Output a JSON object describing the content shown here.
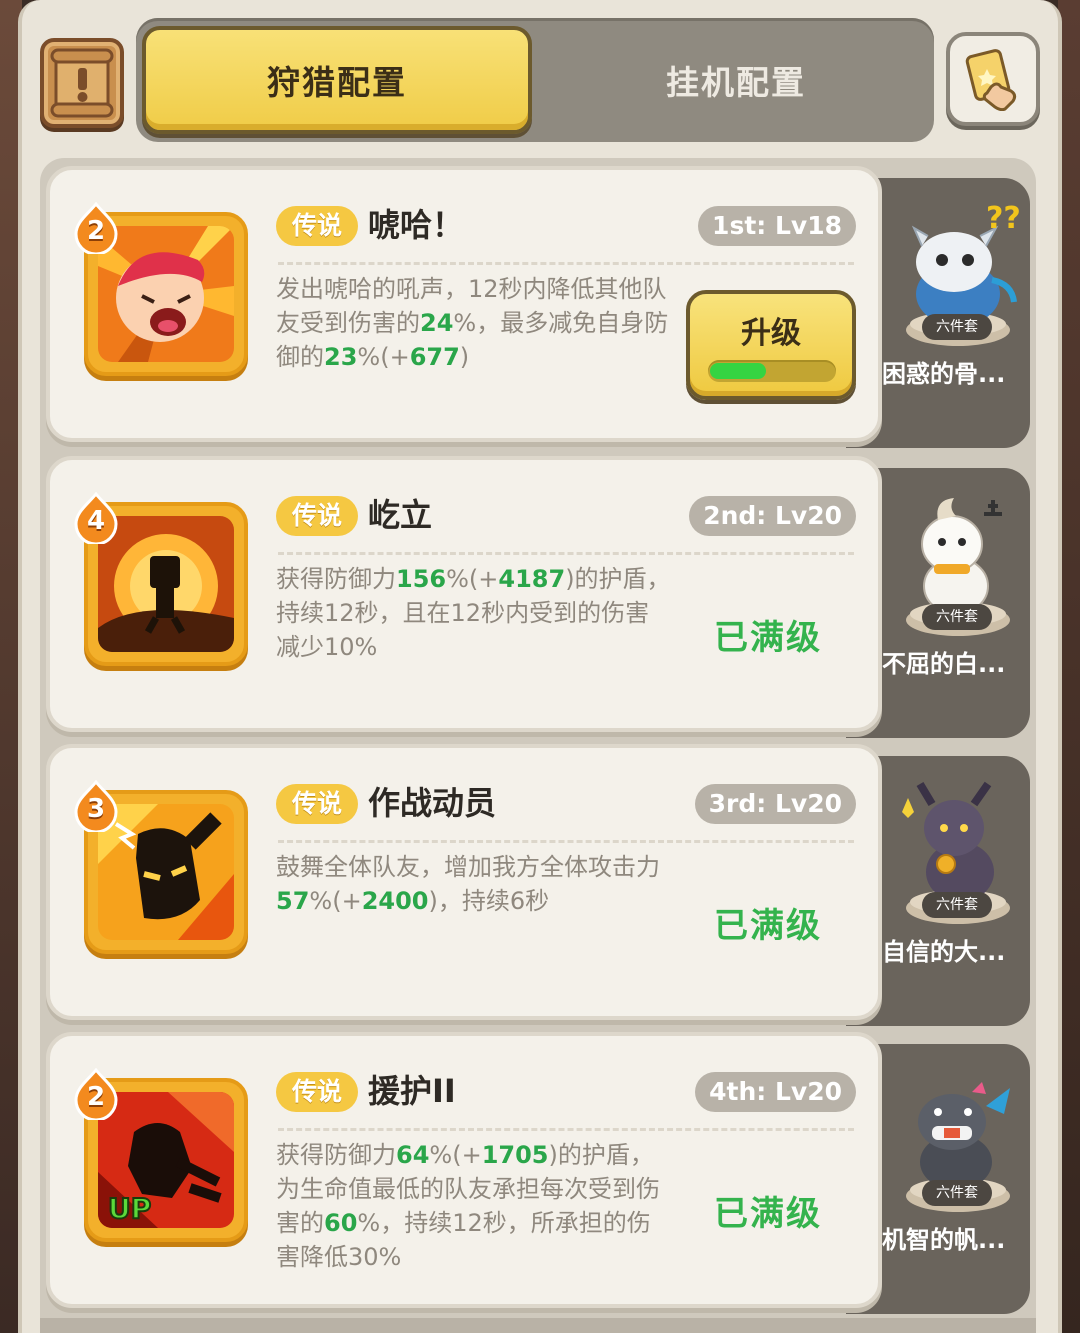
{
  "tabs": [
    {
      "label": "狩猎配置",
      "active": true
    },
    {
      "label": "挂机配置",
      "active": false
    }
  ],
  "toolbar": {
    "left_icon": "scroll-exclaim-icon",
    "right_icon": "hand-card-icon"
  },
  "colors": {
    "rarity": "#f5c842",
    "highlight": "#2aa64a",
    "maxed": "#34b34d",
    "tab_active": "#f0cc47"
  },
  "skills": [
    {
      "count": "2",
      "rarity": "传说",
      "name": "唬哈！",
      "slot": "1st: Lv18",
      "desc_parts": [
        "发出唬哈的吼声，12秒内降低其他队友受到伤害的",
        "24",
        "%，最多减免自身防御的",
        "23",
        "%(+",
        "677",
        ")"
      ],
      "action": "upgrade",
      "upgrade_label": "升级",
      "progress": 0.45,
      "pet_name": "困惑的骨...",
      "pet_tag": "六件套",
      "icon": "shouting-face-icon"
    },
    {
      "count": "4",
      "rarity": "传说",
      "name": "屹立",
      "slot": "2nd: Lv20",
      "desc_parts": [
        "获得防御力",
        "156",
        "%(+",
        "4187",
        ")的护盾，持续12秒，且在12秒内受到的伤害减少10%"
      ],
      "action": "maxed",
      "maxed_label": "已满级",
      "pet_name": "不屈的白...",
      "pet_tag": "六件套",
      "icon": "standing-figure-shield-icon"
    },
    {
      "count": "3",
      "rarity": "传说",
      "name": "作战动员",
      "slot": "3rd: Lv20",
      "desc_parts": [
        "鼓舞全体队友，增加我方全体攻击力",
        "57",
        "%(+",
        "2400",
        ")，持续6秒"
      ],
      "action": "maxed",
      "maxed_label": "已满级",
      "pet_name": "自信的大...",
      "pet_tag": "六件套",
      "icon": "rally-figure-icon"
    },
    {
      "count": "2",
      "rarity": "传说",
      "name": "援护II",
      "slot": "4th: Lv20",
      "desc_parts": [
        "获得防御力",
        "64",
        "%(+",
        "1705",
        ")的护盾，为生命值最低的队友承担每次受到伤害的",
        "60",
        "%，持续12秒，所承担的伤害降低30%"
      ],
      "action": "maxed",
      "maxed_label": "已满级",
      "up_badge": "UP",
      "pet_name": "机智的帆...",
      "pet_tag": "六件套",
      "icon": "guarding-figure-icon"
    }
  ]
}
